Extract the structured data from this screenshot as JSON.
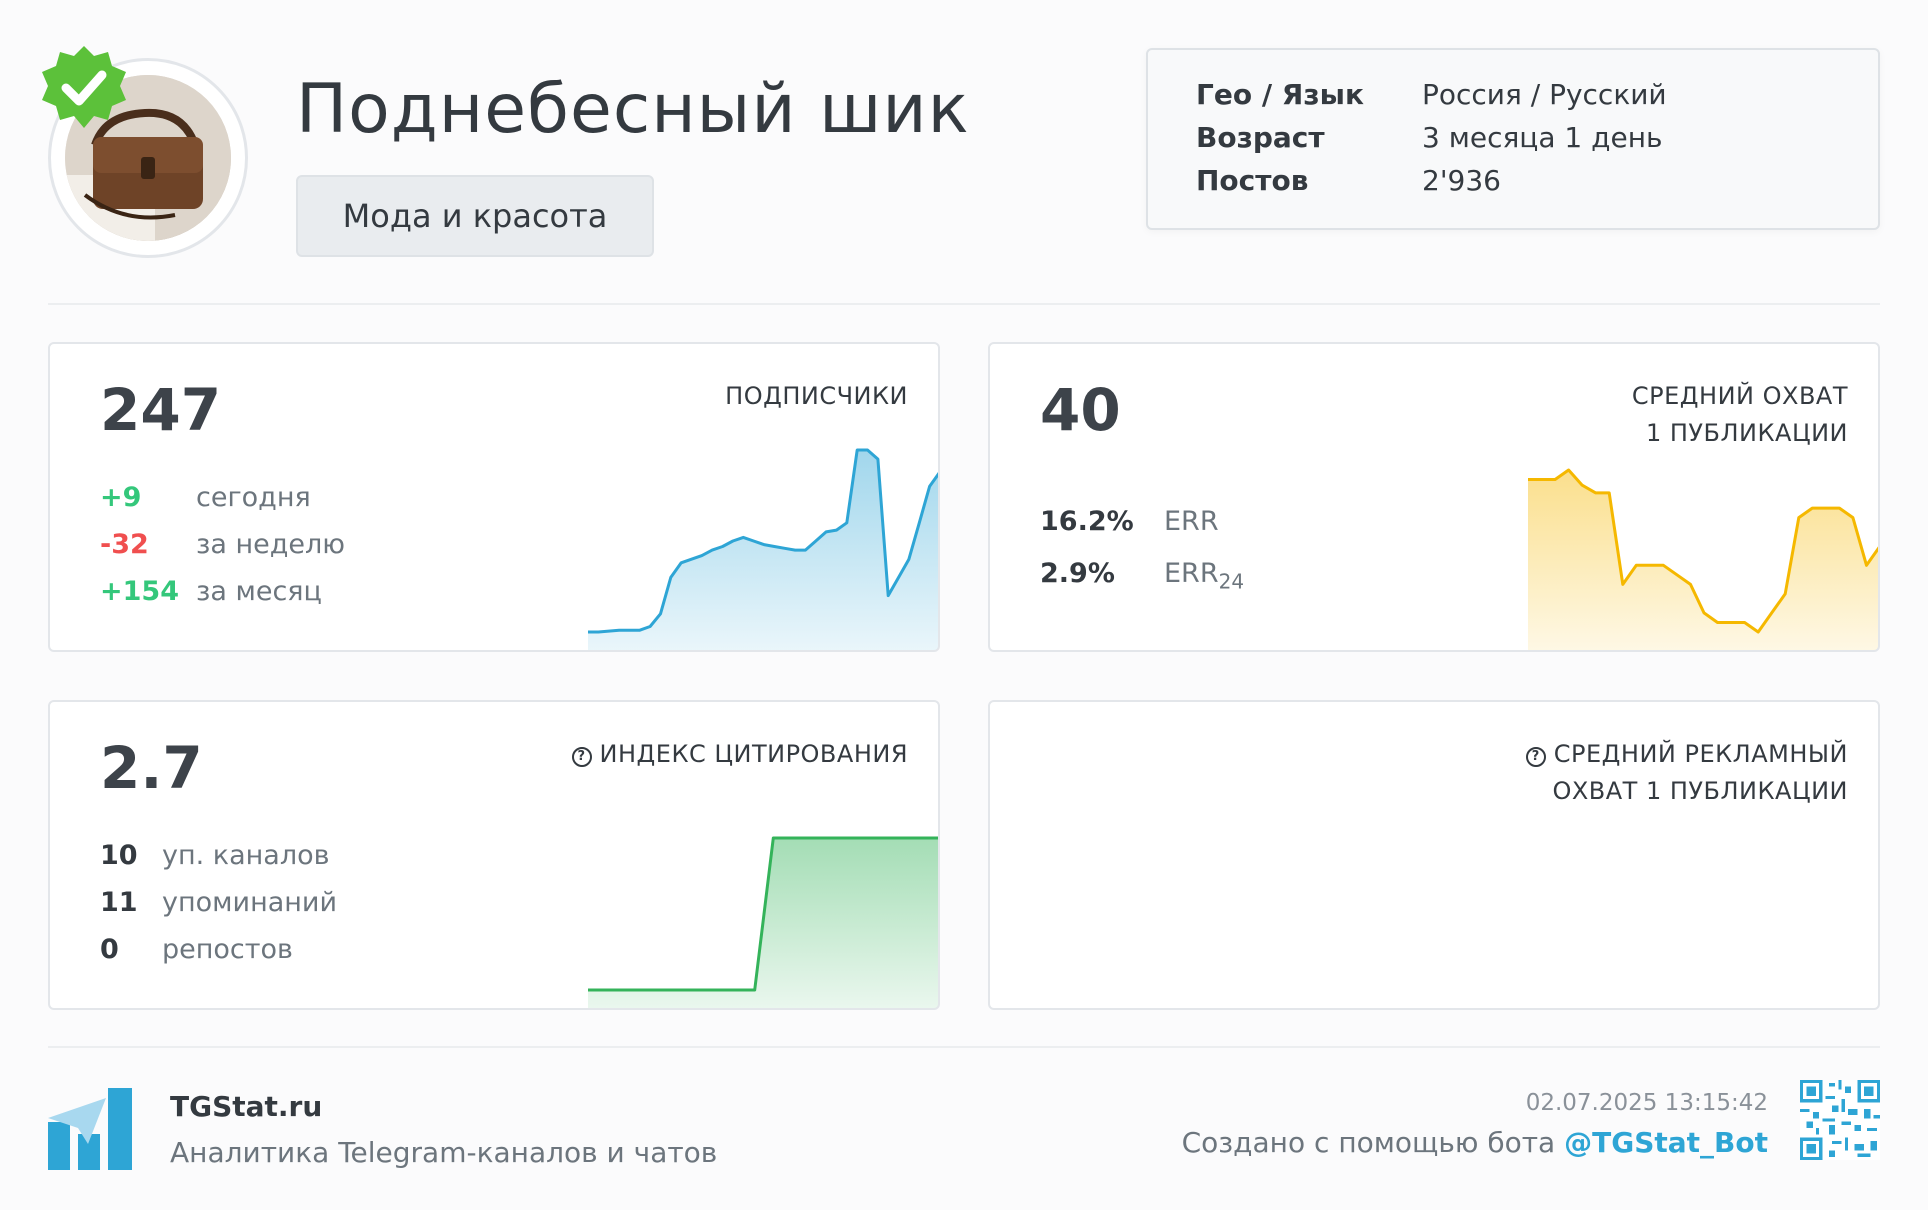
{
  "channel": {
    "title": "Поднебесный шик",
    "category": "Мода и красота",
    "avatar_icon": "handbag-photo",
    "verified_icon": "verified-check-icon"
  },
  "info": {
    "geo_label": "Гео / Язык",
    "geo_value": "Россия / Русский",
    "age_label": "Возраст",
    "age_value": "3 месяца 1 день",
    "posts_label": "Постов",
    "posts_value": "2'936"
  },
  "subscribers": {
    "value": "247",
    "label": "ПОДПИСЧИКИ",
    "today_delta": "+9",
    "today_label": "сегодня",
    "week_delta": "-32",
    "week_label": "за неделю",
    "month_delta": "+154",
    "month_label": "за месяц",
    "color": "#2ea5d5"
  },
  "reach": {
    "value": "40",
    "label_line1": "СРЕДНИЙ ОХВАТ",
    "label_line2": "1 ПУБЛИКАЦИИ",
    "err_value": "16.2%",
    "err_label": "ERR",
    "err24_value": "2.9%",
    "err24_label": "ERR",
    "err24_sub": "24",
    "color": "#f5b800"
  },
  "citation": {
    "value": "2.7",
    "label": "ИНДЕКС ЦИТИРОВАНИЯ",
    "channels_value": "10",
    "channels_label": "уп. каналов",
    "mentions_value": "11",
    "mentions_label": "упоминаний",
    "reposts_value": "0",
    "reposts_label": "репостов",
    "color": "#34b35a"
  },
  "ad_reach": {
    "label_line1": "СРЕДНИЙ РЕКЛАМНЫЙ",
    "label_line2": "ОХВАТ 1 ПУБЛИКАЦИИ"
  },
  "footer": {
    "brand": "TGStat.ru",
    "tagline": "Аналитика Telegram-каналов и чатов",
    "date": "02.07.2025 13:15:42",
    "created_text": "Создано с помощью бота",
    "bot_link": "@TGStat_Bot",
    "qr_icon": "qr-code-icon",
    "logo_icon": "tgstat-logo-icon"
  },
  "chart_data": [
    {
      "type": "area",
      "name": "subscribers",
      "values": [
        0,
        0,
        0.5,
        1,
        1,
        1,
        3,
        10,
        30,
        38,
        40,
        42,
        45,
        47,
        50,
        52,
        50,
        48,
        47,
        46,
        45,
        45,
        50,
        55,
        56,
        60,
        100,
        100,
        95,
        20,
        30,
        40,
        60,
        80,
        88
      ]
    },
    {
      "type": "area",
      "name": "avg_reach",
      "values": [
        75,
        75,
        75,
        80,
        72,
        68,
        68,
        20,
        30,
        30,
        30,
        25,
        20,
        5,
        0,
        0,
        0,
        -5,
        5,
        15,
        55,
        60,
        60,
        60,
        55,
        30,
        40
      ]
    },
    {
      "type": "area",
      "name": "citation_index",
      "values": [
        0,
        0,
        0,
        0,
        0,
        0,
        0,
        0,
        0,
        0,
        1,
        1,
        1,
        1,
        1,
        1,
        1,
        1,
        1,
        1
      ]
    }
  ]
}
